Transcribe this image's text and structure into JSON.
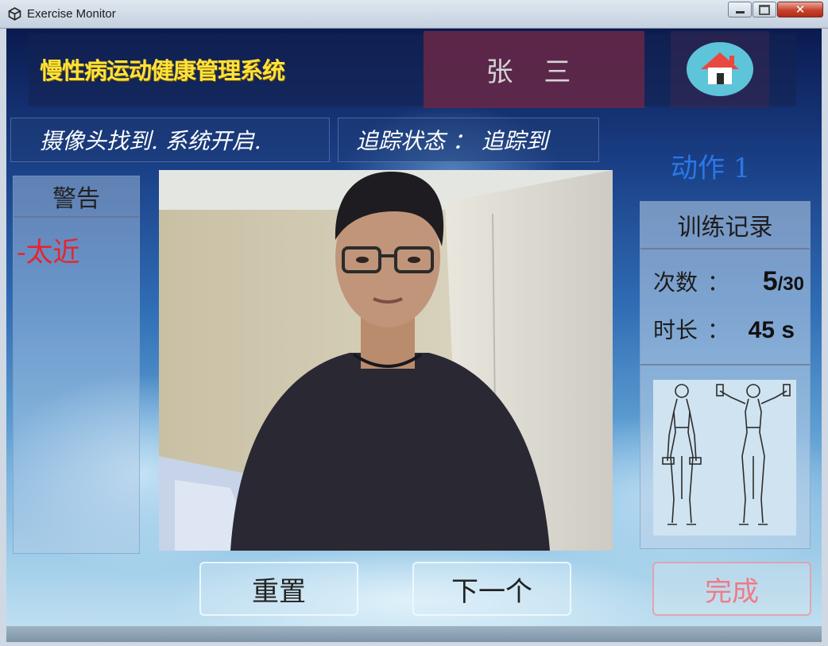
{
  "window": {
    "title": "Exercise Monitor",
    "minimize_icon": "minimize-icon",
    "maximize_icon": "maximize-icon",
    "close_icon": "close-icon",
    "close_glyph": "✕"
  },
  "header": {
    "system_title": "慢性病运动健康管理系统",
    "user_name": "张 三",
    "home_icon": "home-icon"
  },
  "status": {
    "camera_status": "摄像头找到.  系统开启.",
    "tracking_status": "追踪状态 ：  追踪到"
  },
  "action_label": "动作 1",
  "warning": {
    "title": "警告",
    "message": "-太近"
  },
  "record": {
    "title": "训练记录",
    "count_label": "次数",
    "count_colon": "：",
    "count_value": "5",
    "count_total": "/30",
    "duration_label": "时长",
    "duration_colon": "：",
    "duration_value": "45 s",
    "exercise_image": "lateral-raise-illustration"
  },
  "buttons": {
    "reset": "重置",
    "next": "下一个",
    "done": "完成"
  },
  "colors": {
    "title_yellow": "#ffe23a",
    "warning_red": "#e8232e",
    "action_blue": "#2a78e6",
    "done_pink": "#ee7b86"
  }
}
